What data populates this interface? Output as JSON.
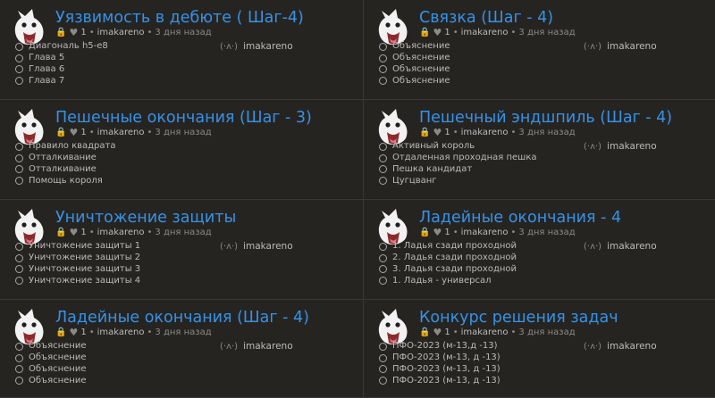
{
  "colors": {
    "title": "#3692e7",
    "background": "#262421",
    "lock": "#d59020"
  },
  "studies": [
    {
      "title": "Уязвимость в дебюте ( Шаг-4)",
      "likes": "1",
      "separator": "•",
      "owner": "imakareno",
      "time": "3 дня назад",
      "chapters": [
        "Диагональ h5-e8",
        "Глава 5",
        "Глава 6",
        "Глава 7"
      ],
      "member": "imakareno"
    },
    {
      "title": "Связка (Шаг - 4)",
      "likes": "1",
      "separator": "•",
      "owner": "imakareno",
      "time": "3 дня назад",
      "chapters": [
        "Объяснение",
        "Объяснение",
        "Объяснение",
        "Объяснение"
      ],
      "member": "imakareno"
    },
    {
      "title": "Пешечные окончания (Шаг - 3)",
      "likes": "1",
      "separator": "•",
      "owner": "imakareno",
      "time": "3 дня назад",
      "chapters": [
        "Правило квадрата",
        "Отталкивание",
        "Отталкивание",
        "Помощь короля"
      ],
      "member": ""
    },
    {
      "title": "Пешечный эндшпиль (Шаг - 4)",
      "likes": "1",
      "separator": "•",
      "owner": "imakareno",
      "time": "3 дня назад",
      "chapters": [
        "Активный король",
        "Отдаленная проходная пешка",
        "Пешка кандидат",
        "Цугцванг"
      ],
      "member": "imakareno"
    },
    {
      "title": "Уничтожение защиты",
      "likes": "1",
      "separator": "•",
      "owner": "imakareno",
      "time": "3 дня назад",
      "chapters": [
        "Уничтожение защиты 1",
        "Уничтожение защиты 2",
        "Уничтожение защиты 3",
        "Уничтожение защиты 4"
      ],
      "member": "imakareno"
    },
    {
      "title": "Ладейные окончания - 4",
      "likes": "1",
      "separator": "•",
      "owner": "imakareno",
      "time": "3 дня назад",
      "chapters": [
        "1. Ладья сзади проходной",
        "2. Ладья сзади проходной",
        "3. Ладья сзади проходной",
        "1. Ладья - универсал"
      ],
      "member": "imakareno"
    },
    {
      "title": "Ладейные окончания (Шаг - 4)",
      "likes": "1",
      "separator": "•",
      "owner": "imakareno",
      "time": "3 дня назад",
      "chapters": [
        "Объяснение",
        "Объяснение",
        "Объяснение",
        "Объяснение"
      ],
      "member": "imakareno"
    },
    {
      "title": "Конкурс решения задач",
      "likes": "1",
      "separator": "•",
      "owner": "imakareno",
      "time": "3 дня назад",
      "chapters": [
        "ПФО-2023 (м-13,д -13)",
        "ПФО-2023 (м-13, д -13)",
        "ПФО-2023 (м-13, д -13)",
        "ПФО-2023 (м-13, д -13)"
      ],
      "member": "imakareno"
    }
  ]
}
